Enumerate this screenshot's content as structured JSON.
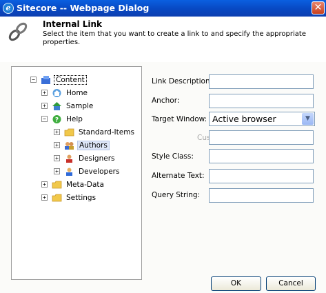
{
  "window": {
    "title": "Sitecore -- Webpage Dialog",
    "close_glyph": "✕"
  },
  "header": {
    "title": "Internal Link",
    "description": "Select the item that you want to create a link to and specify the appropriate properties."
  },
  "tree": {
    "root": "Content",
    "home": "Home",
    "sample": "Sample",
    "help": "Help",
    "standard_items": "Standard-Items",
    "authors": "Authors",
    "designers": "Designers",
    "developers": "Developers",
    "meta_data": "Meta-Data",
    "settings": "Settings",
    "expand_glyph": "+",
    "collapse_glyph": "−"
  },
  "form": {
    "link_description": {
      "label": "Link Description:",
      "value": ""
    },
    "anchor": {
      "label": "Anchor:",
      "value": ""
    },
    "target_window": {
      "label": "Target Window:",
      "value": "Active browser"
    },
    "custom": {
      "label": "Custom:",
      "value": ""
    },
    "style_class": {
      "label": "Style Class:",
      "value": ""
    },
    "alternate_text": {
      "label": "Alternate Text:",
      "value": ""
    },
    "query_string": {
      "label": "Query String:",
      "value": ""
    }
  },
  "buttons": {
    "ok": "OK",
    "cancel": "Cancel"
  },
  "colors": {
    "titlebar": "#0848c2",
    "selection": "#dde6f7",
    "input_border": "#7f9db9"
  }
}
